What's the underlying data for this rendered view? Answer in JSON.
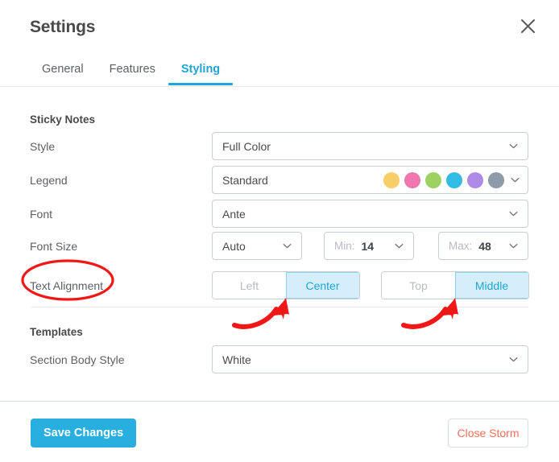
{
  "window": {
    "title": "Settings",
    "close_icon": "close-x-icon"
  },
  "tabs": [
    {
      "label": "General",
      "active": false
    },
    {
      "label": "Features",
      "active": false
    },
    {
      "label": "Styling",
      "active": true
    }
  ],
  "sections": {
    "sticky_notes": {
      "title": "Sticky Notes",
      "rows": {
        "style": {
          "label": "Style",
          "value": "Full Color"
        },
        "legend": {
          "label": "Legend",
          "value": "Standard",
          "swatches": [
            "#f7ce68",
            "#ef77ad",
            "#9dd162",
            "#33bde6",
            "#ad8ae6",
            "#8e9aa8"
          ]
        },
        "font": {
          "label": "Font",
          "value": "Ante"
        },
        "font_size": {
          "label": "Font Size",
          "mode": "Auto",
          "min_prefix": "Min:",
          "min_value": "14",
          "max_prefix": "Max:",
          "max_value": "48"
        },
        "text_alignment": {
          "label": "Text Alignment",
          "horizontal": [
            {
              "label": "Left",
              "active": false
            },
            {
              "label": "Center",
              "active": true
            }
          ],
          "vertical": [
            {
              "label": "Top",
              "active": false
            },
            {
              "label": "Middle",
              "active": true
            }
          ]
        }
      }
    },
    "templates": {
      "title": "Templates",
      "rows": {
        "section_body_style": {
          "label": "Section Body Style",
          "value": "White"
        }
      }
    }
  },
  "footer": {
    "save_label": "Save Changes",
    "close_label": "Close Storm"
  },
  "annotations": {
    "color": "#f01717",
    "ellipse_target": "Text Alignment",
    "arrow_left_target": "Center",
    "arrow_right_target": "Middle"
  },
  "colors": {
    "accent": "#1ba7d8",
    "accent_fill": "#d5eefb",
    "save_button": "#29aee0",
    "close_storm_text": "#f2705a",
    "label_text": "#5b6066",
    "border": "#c9ced3"
  }
}
